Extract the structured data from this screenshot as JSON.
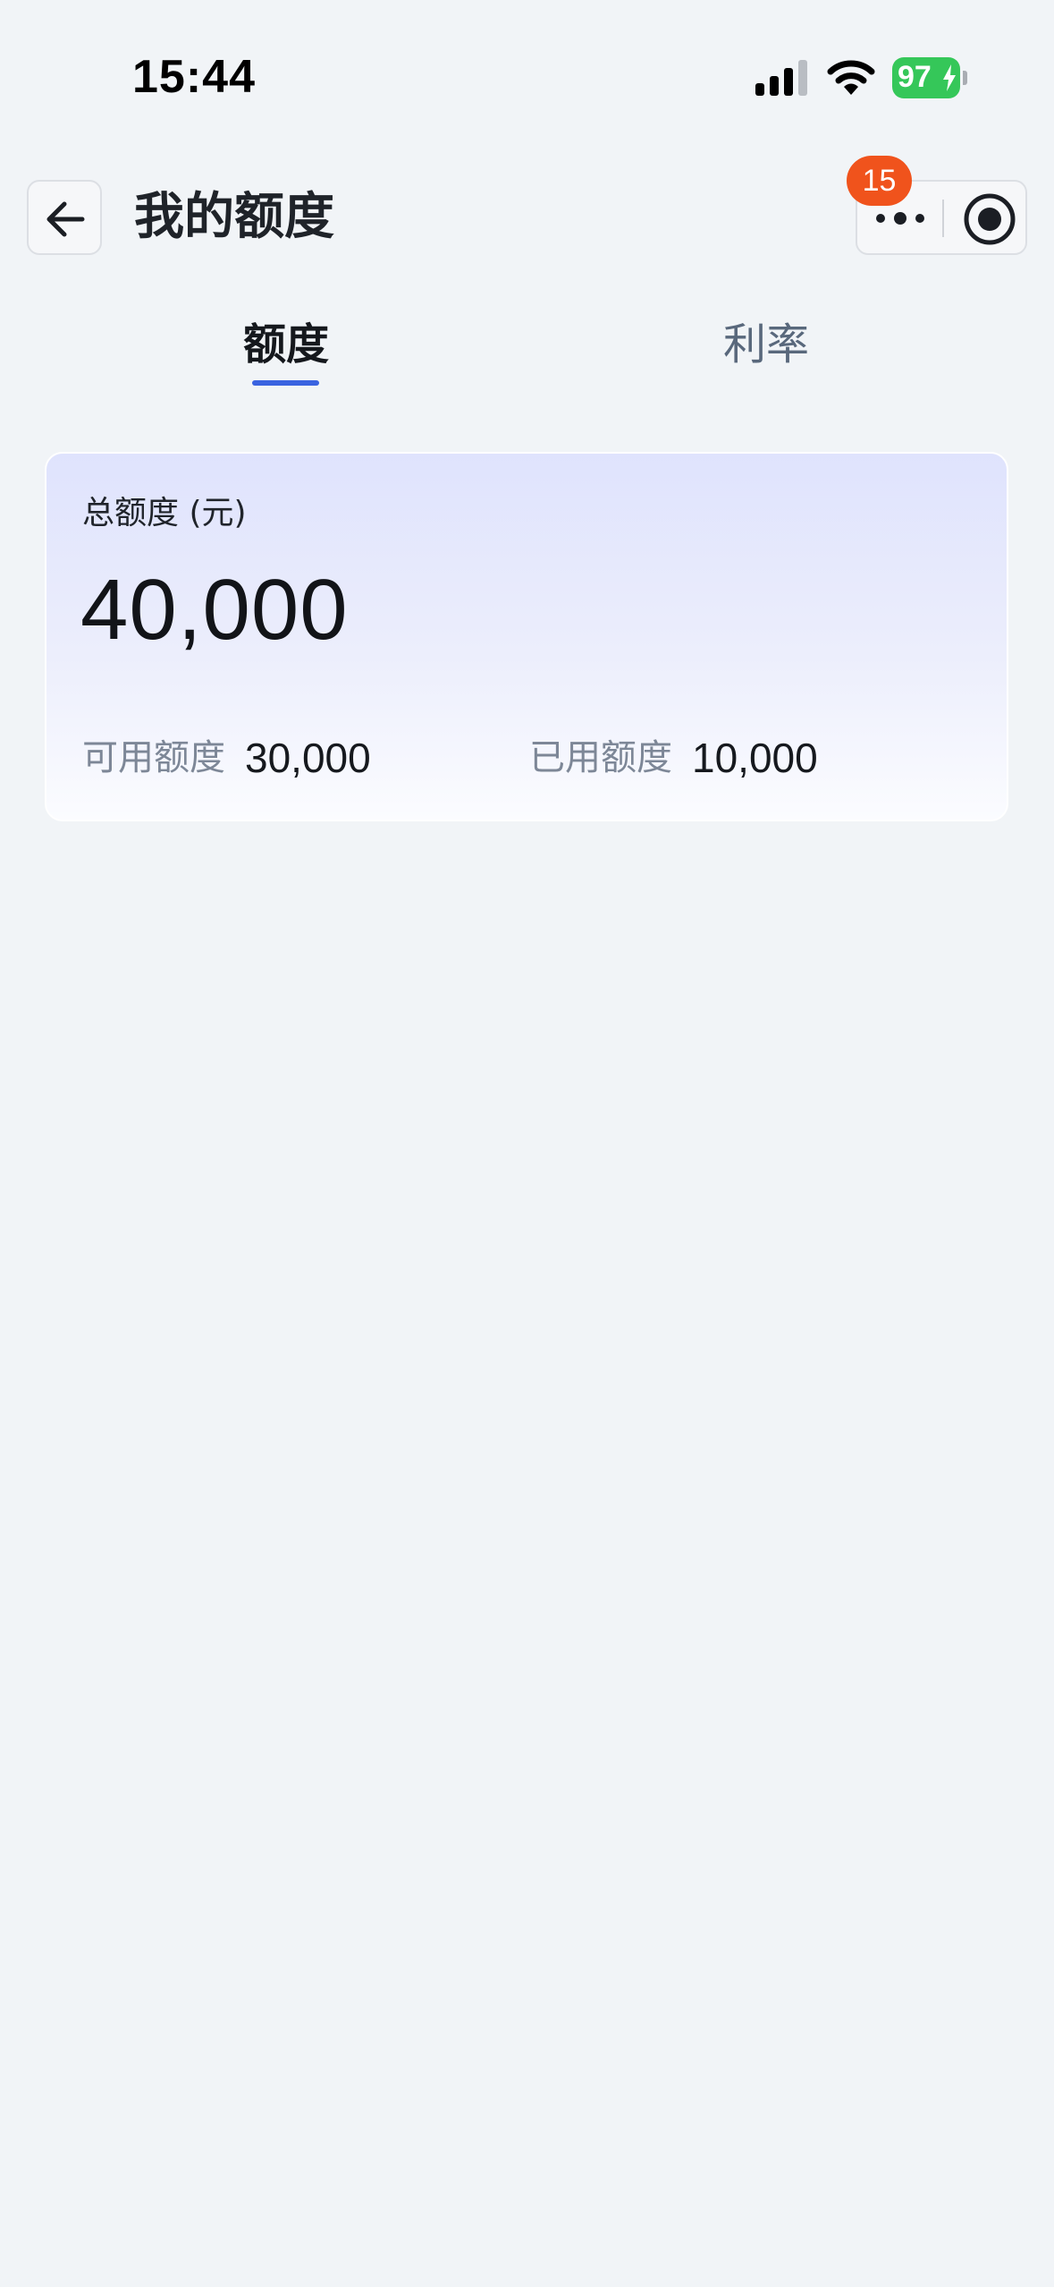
{
  "status_bar": {
    "time": "15:44",
    "battery_level": "97",
    "battery_charging": true,
    "icons": [
      "signal-icon",
      "wifi-icon",
      "battery-icon"
    ]
  },
  "nav": {
    "title": "我的额度",
    "badge_count": "15",
    "icons": [
      "arrow-left-icon",
      "more-dots-icon",
      "target-icon"
    ]
  },
  "tabs": [
    {
      "label": "额度",
      "active": true
    },
    {
      "label": "利率",
      "active": false
    }
  ],
  "quota_card": {
    "total_label": "总额度 (元)",
    "total_amount": "40,000",
    "available_label": "可用额度",
    "available_value": "30,000",
    "used_label": "已用额度",
    "used_value": "10,000"
  },
  "colors": {
    "accent": "#3a63e0",
    "badge": "#f0531c",
    "battery": "#35c759",
    "background": "#f1f4f7"
  }
}
